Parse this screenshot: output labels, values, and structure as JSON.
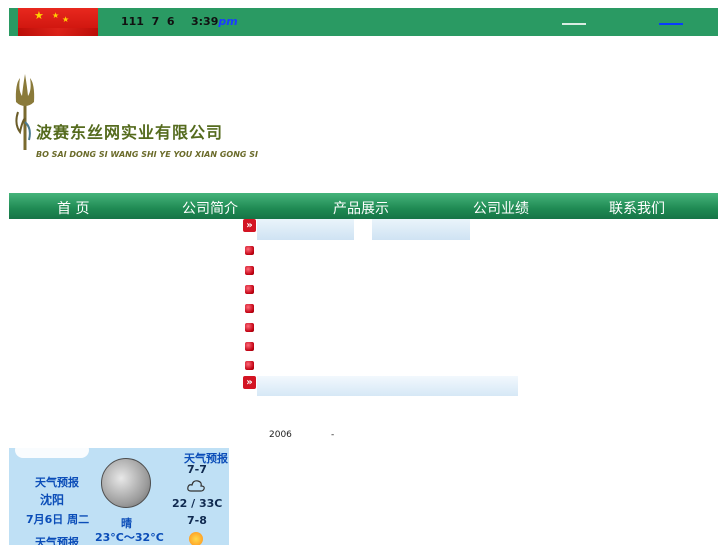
{
  "topbar": {
    "date_text": "111  7  6",
    "time_text": "3:39",
    "time_suffix": "pm"
  },
  "header": {
    "company_name_cn": "波赛东丝网实业有限公司",
    "company_name_pinyin": "BO SAI DONG SI WANG SHI YE YOU XIAN GONG SI"
  },
  "nav": {
    "items": [
      "首  页",
      "公司简介",
      "产品展示",
      "公司业绩",
      "联系我们"
    ]
  },
  "footer": {
    "year": "2006",
    "separator": "-"
  },
  "weather": {
    "left_line1": "天气预报",
    "left_line2": "沈阳",
    "left_line3": "7月6日 周二",
    "left_line4": "天气预报",
    "today_condition": "晴",
    "today_temp": "23°C～32°C",
    "right_title": "天气预报",
    "day1_date": "7-7",
    "day1_temp": "22 / 33C",
    "day2_date": "7-8",
    "icons": [
      "moon-icon",
      "cloud-icon",
      "sun-icon"
    ]
  },
  "colors": {
    "topbar": "#2a9a63",
    "nav": "#1f8a53",
    "weather_bg": "#bfe0f5",
    "bullet": "#c00010"
  }
}
